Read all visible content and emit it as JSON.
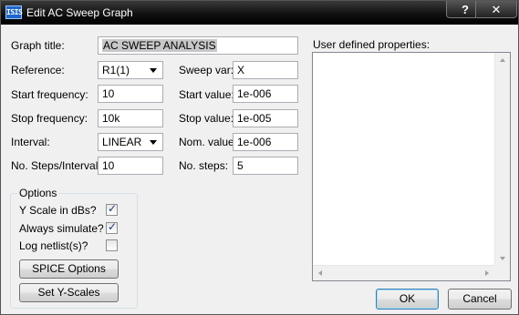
{
  "window": {
    "title": "Edit AC Sweep Graph",
    "icon_text": "ISIS",
    "help_glyph": "?",
    "close_glyph": "✕"
  },
  "form": {
    "graph_title_label": "Graph title:",
    "graph_title_value": "AC SWEEP ANALYSIS",
    "reference_label": "Reference:",
    "reference_value": "R1(1)",
    "sweep_var_label": "Sweep var:",
    "sweep_var_value": "X",
    "start_freq_label": "Start frequency:",
    "start_freq_value": "10",
    "start_value_label": "Start value:",
    "start_value_value": "1e-006",
    "stop_freq_label": "Stop frequency:",
    "stop_freq_value": "10k",
    "stop_value_label": "Stop value:",
    "stop_value_value": "1e-005",
    "interval_label": "Interval:",
    "interval_value": "LINEAR",
    "nom_value_label": "Nom. value:",
    "nom_value_value": "1e-006",
    "steps_interval_label": "No. Steps/Interval:",
    "steps_interval_value": "10",
    "no_steps_label": "No. steps:",
    "no_steps_value": "5"
  },
  "options": {
    "title": "Options",
    "y_scale_db_label": "Y Scale in dBs?",
    "y_scale_db_checked": true,
    "always_simulate_label": "Always simulate?",
    "always_simulate_checked": true,
    "log_netlist_label": "Log netlist(s)?",
    "log_netlist_checked": false,
    "spice_options_label": "SPICE Options",
    "set_y_scales_label": "Set Y-Scales"
  },
  "user_props": {
    "label": "User defined properties:"
  },
  "buttons": {
    "ok": "OK",
    "cancel": "Cancel"
  },
  "glyphs": {
    "check": "✓"
  }
}
